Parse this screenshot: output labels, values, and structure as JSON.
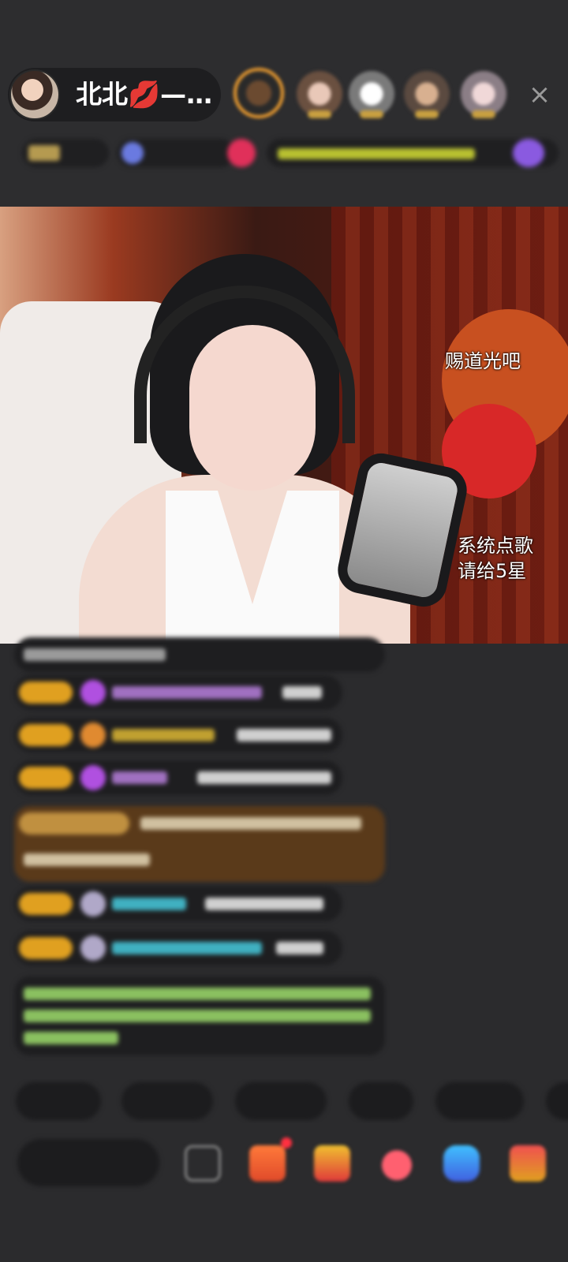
{
  "host": {
    "name": "北北💋—…",
    "kiss_icon": "💋"
  },
  "header": {
    "close_icon": "×"
  },
  "stream": {
    "overlay_light": "赐道光吧",
    "overlay_song_line1": "系统点歌",
    "overlay_song_line2": "请给5星"
  },
  "colors": {
    "background": "#2b2b2d",
    "level_badge": "#e0a020",
    "ranking_ring": "#f3a030"
  }
}
